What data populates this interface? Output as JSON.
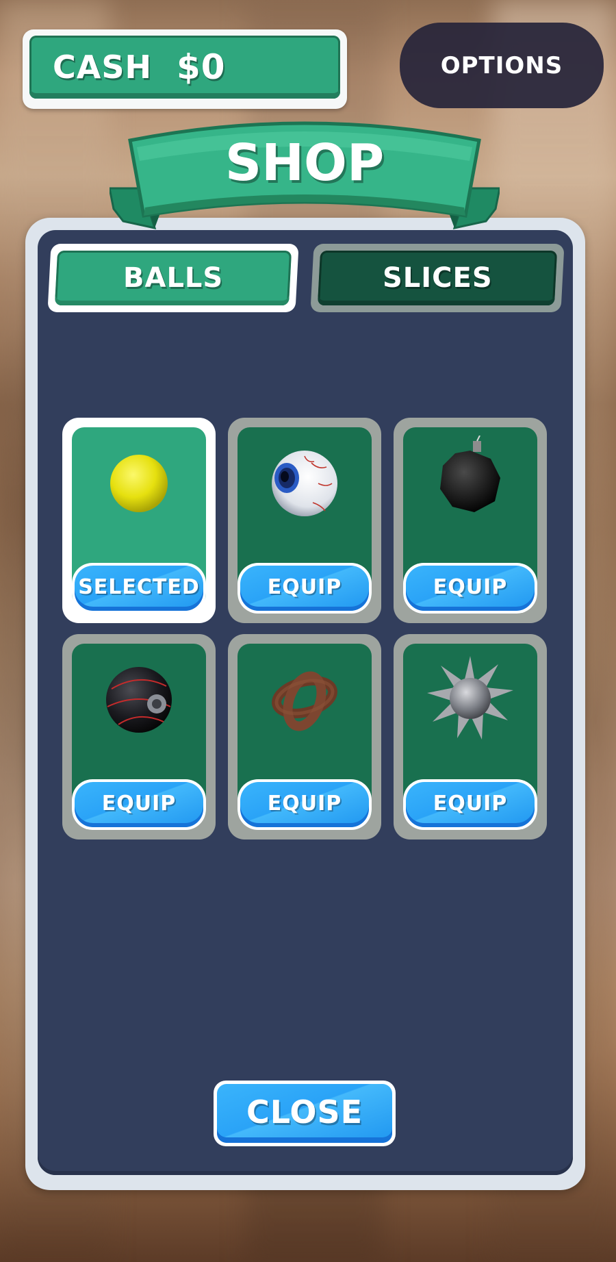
{
  "header": {
    "cash_label": "CASH",
    "cash_value": "$0",
    "options_label": "OPTIONS"
  },
  "shop": {
    "title": "SHOP",
    "tabs": [
      {
        "label": "BALLS",
        "active": true
      },
      {
        "label": "SLICES",
        "active": false
      }
    ],
    "items": [
      {
        "icon": "yellow-ball-icon",
        "button_label": "SELECTED",
        "selected": true
      },
      {
        "icon": "eyeball-icon",
        "button_label": "EQUIP",
        "selected": false
      },
      {
        "icon": "bomb-icon",
        "button_label": "EQUIP",
        "selected": false
      },
      {
        "icon": "black-red-ball-icon",
        "button_label": "EQUIP",
        "selected": false
      },
      {
        "icon": "knot-icon",
        "button_label": "EQUIP",
        "selected": false
      },
      {
        "icon": "spiked-ball-icon",
        "button_label": "EQUIP",
        "selected": false
      }
    ],
    "close_label": "CLOSE"
  },
  "colors": {
    "green": "#2fa77e",
    "dark_green": "#15533f",
    "panel": "#323e5c",
    "blue_button": "#2aa3f7"
  }
}
